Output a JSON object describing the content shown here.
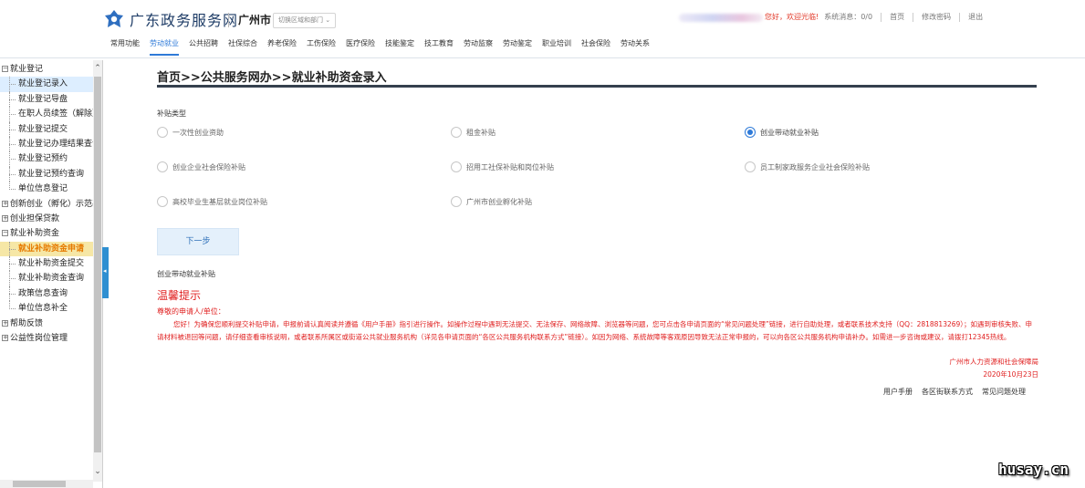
{
  "header": {
    "site_title": "广东政务服务网",
    "city": "广州市",
    "city_switch": "切换区域和部门 ⌄",
    "greeting": "您好，欢迎光临!",
    "message": "系统消息：0/0",
    "home": "首页",
    "change_password": "修改密码",
    "logout": "退出"
  },
  "nav": [
    {
      "label": "常用功能"
    },
    {
      "label": "劳动就业"
    },
    {
      "label": "公共招聘"
    },
    {
      "label": "社保综合"
    },
    {
      "label": "养老保险"
    },
    {
      "label": "工伤保险"
    },
    {
      "label": "医疗保险"
    },
    {
      "label": "技能鉴定"
    },
    {
      "label": "技工教育"
    },
    {
      "label": "劳动监察"
    },
    {
      "label": "劳动鉴定"
    },
    {
      "label": "职业培训"
    },
    {
      "label": "社会保险"
    },
    {
      "label": "劳动关系"
    }
  ],
  "sidebar": {
    "g1": "就业登记",
    "g1_items": [
      "就业登记录入",
      "就业登记导盘",
      "在职人员续签（解除）",
      "就业登记提交",
      "就业登记办理结果查询",
      "就业登记预约",
      "就业登记预约查询",
      "单位信息登记"
    ],
    "g2": "创新创业（孵化）示范基地",
    "g3": "创业担保贷款",
    "g4": "就业补助资金",
    "g4_items": [
      "就业补助资金申请",
      "就业补助资金提交",
      "就业补助资金查询",
      "政策信息查询",
      "单位信息补全"
    ],
    "g5": "帮助反馈",
    "g6": "公益性岗位管理"
  },
  "main": {
    "breadcrumb": "首页>>公共服务网办>>就业补助资金录入",
    "subsidy_type_label": "补贴类型",
    "options": [
      "一次性创业资助",
      "租金补贴",
      "创业带动就业补贴",
      "创业企业社会保险补贴",
      "招用工社保补贴和岗位补贴",
      "员工制家政服务企业社会保险补贴",
      "高校毕业生基层就业岗位补贴",
      "广州市创业孵化补贴"
    ],
    "next_button": "下一步",
    "selected_label": "创业带动就业补贴",
    "notice_title": "温馨提示",
    "notice_dear": "尊敬的申请人/单位：",
    "notice_body": "您好！为确保您顺利提交补贴申请，申报前请认真阅读并遵循《用户手册》指引进行操作。如操作过程中遇到无法提交、无法保存、网络故障、浏览器等问题，您可点击各申请页面的“常见问题处理”链接，进行自助处理，或者联系技术支持（QQ：2818813269）；如遇到审核失败、申请材料被退回等问题，请仔细查看审核说明，或者联系所属区或街道公共就业服务机构（详见各申请页面的“各区公共服务机构联系方式”链接）。如因为网络、系统故障等客观原因导致无法正常申报的，可以向各区公共服务机构申请补办。如需进一步咨询或建议，请拨打12345热线。",
    "sign_org": "广州市人力资源和社会保障局",
    "sign_date": "2020年10月23日",
    "links": [
      "用户手册",
      "各区街联系方式",
      "常见问题处理"
    ]
  },
  "watermark": "husay.cn",
  "colors": {
    "accent": "#2e7ad8",
    "notice": "#e02020",
    "highlight": "#e67a00"
  }
}
